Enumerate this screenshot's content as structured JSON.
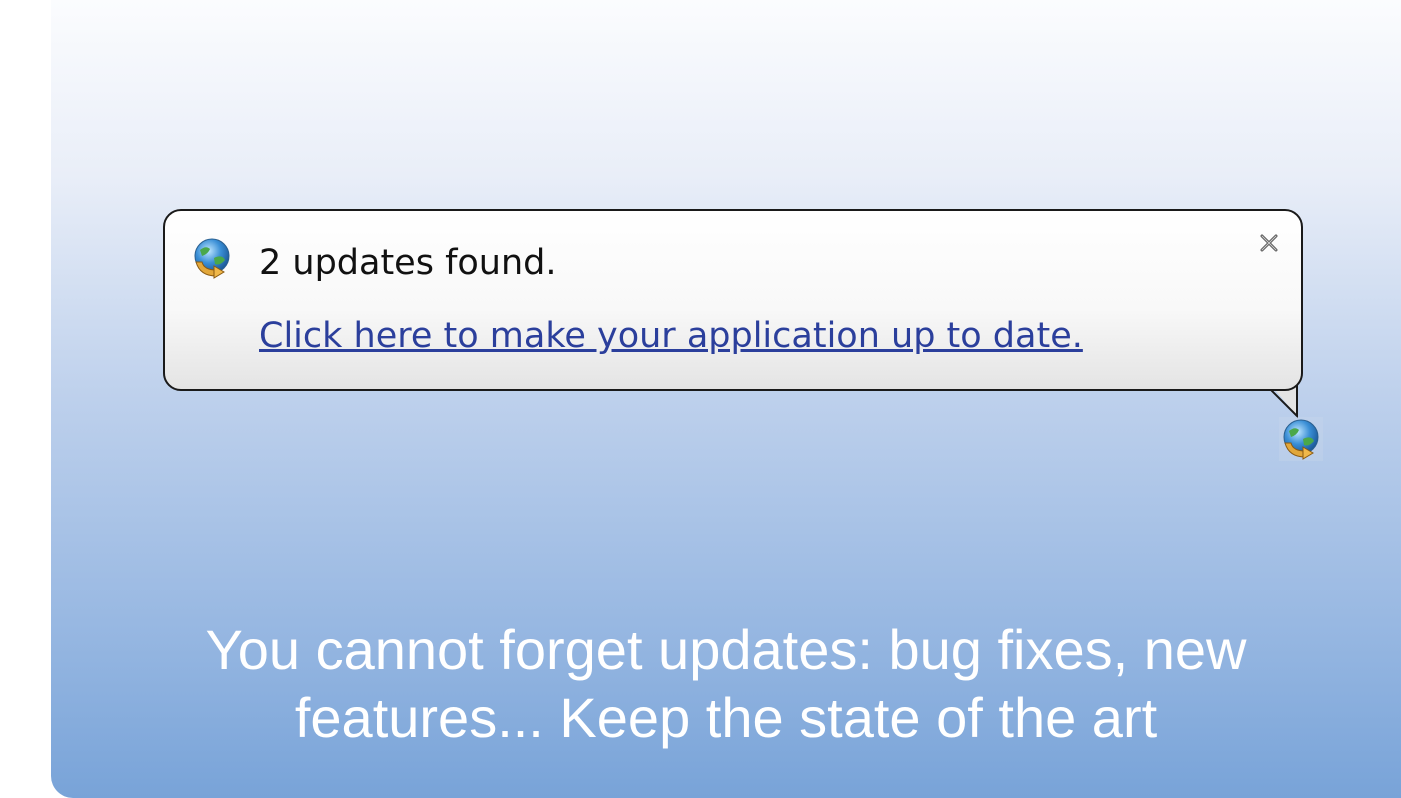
{
  "notification": {
    "icon": "update-globe-icon",
    "title": "2 updates found.",
    "link": "Click here to make your application up to date.",
    "close_icon": "close-icon"
  },
  "tray": {
    "icon": "update-globe-icon"
  },
  "caption": {
    "line1": "You cannot forget updates: bug fixes, new",
    "line2": "features... Keep the state of the art"
  },
  "colors": {
    "link": "#2b3f9c",
    "balloon_border": "#1a1a1a",
    "background_top": "#fbfcfe",
    "background_bottom": "#78a3d8",
    "caption_text": "#ffffff"
  }
}
